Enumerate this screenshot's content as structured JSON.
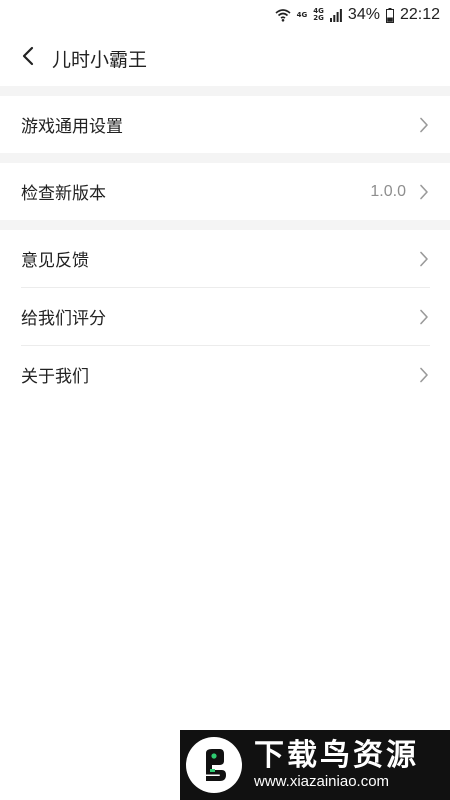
{
  "status_bar": {
    "net_top": "4G",
    "net_mid": "4G",
    "net_bottom": "2G",
    "battery": "34%",
    "time": "22:12"
  },
  "header": {
    "title": "儿时小霸王"
  },
  "groups": [
    {
      "items": [
        {
          "label": "游戏通用设置"
        }
      ]
    },
    {
      "items": [
        {
          "label": "检查新版本",
          "value": "1.0.0"
        }
      ]
    },
    {
      "items": [
        {
          "label": "意见反馈"
        },
        {
          "label": "给我们评分"
        },
        {
          "label": "关于我们"
        }
      ]
    }
  ],
  "watermark": {
    "title": "下载鸟资源",
    "url": "www.xiazainiao.com"
  },
  "colors": {
    "section_gap": "#f4f4f4",
    "divider": "#ececec",
    "chevron": "#9a9a9a",
    "value_text": "#8e8e8e"
  }
}
